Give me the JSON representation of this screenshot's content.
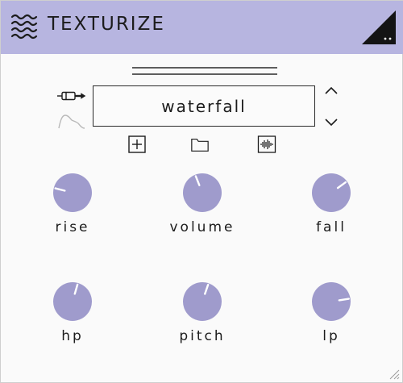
{
  "app": {
    "title": "TEXTURIZE",
    "logo_icon": "waves-icon",
    "corner_icon": "menu-triangle-icon"
  },
  "preset": {
    "name": "waterfall",
    "input_icon": "audio-plug-icon",
    "envelope_icon": "envelope-icon",
    "prev_icon": "chevron-up-icon",
    "next_icon": "chevron-down-icon"
  },
  "actions": {
    "add_icon": "add-preset-icon",
    "folder_icon": "folder-icon",
    "waveform_icon": "waveform-icon"
  },
  "knobs": [
    {
      "id": "rise",
      "label": "rise",
      "value": 0.22
    },
    {
      "id": "volume",
      "label": "volume",
      "value": 0.42
    },
    {
      "id": "fall",
      "label": "fall",
      "value": 0.7
    },
    {
      "id": "hp",
      "label": "hp",
      "value": 0.56
    },
    {
      "id": "pitch",
      "label": "pitch",
      "value": 0.57
    },
    {
      "id": "lp",
      "label": "lp",
      "value": 0.8
    }
  ],
  "colors": {
    "header": "#b7b5e0",
    "knob_fill": "#9f9bcc",
    "text": "#1c1c1c"
  }
}
